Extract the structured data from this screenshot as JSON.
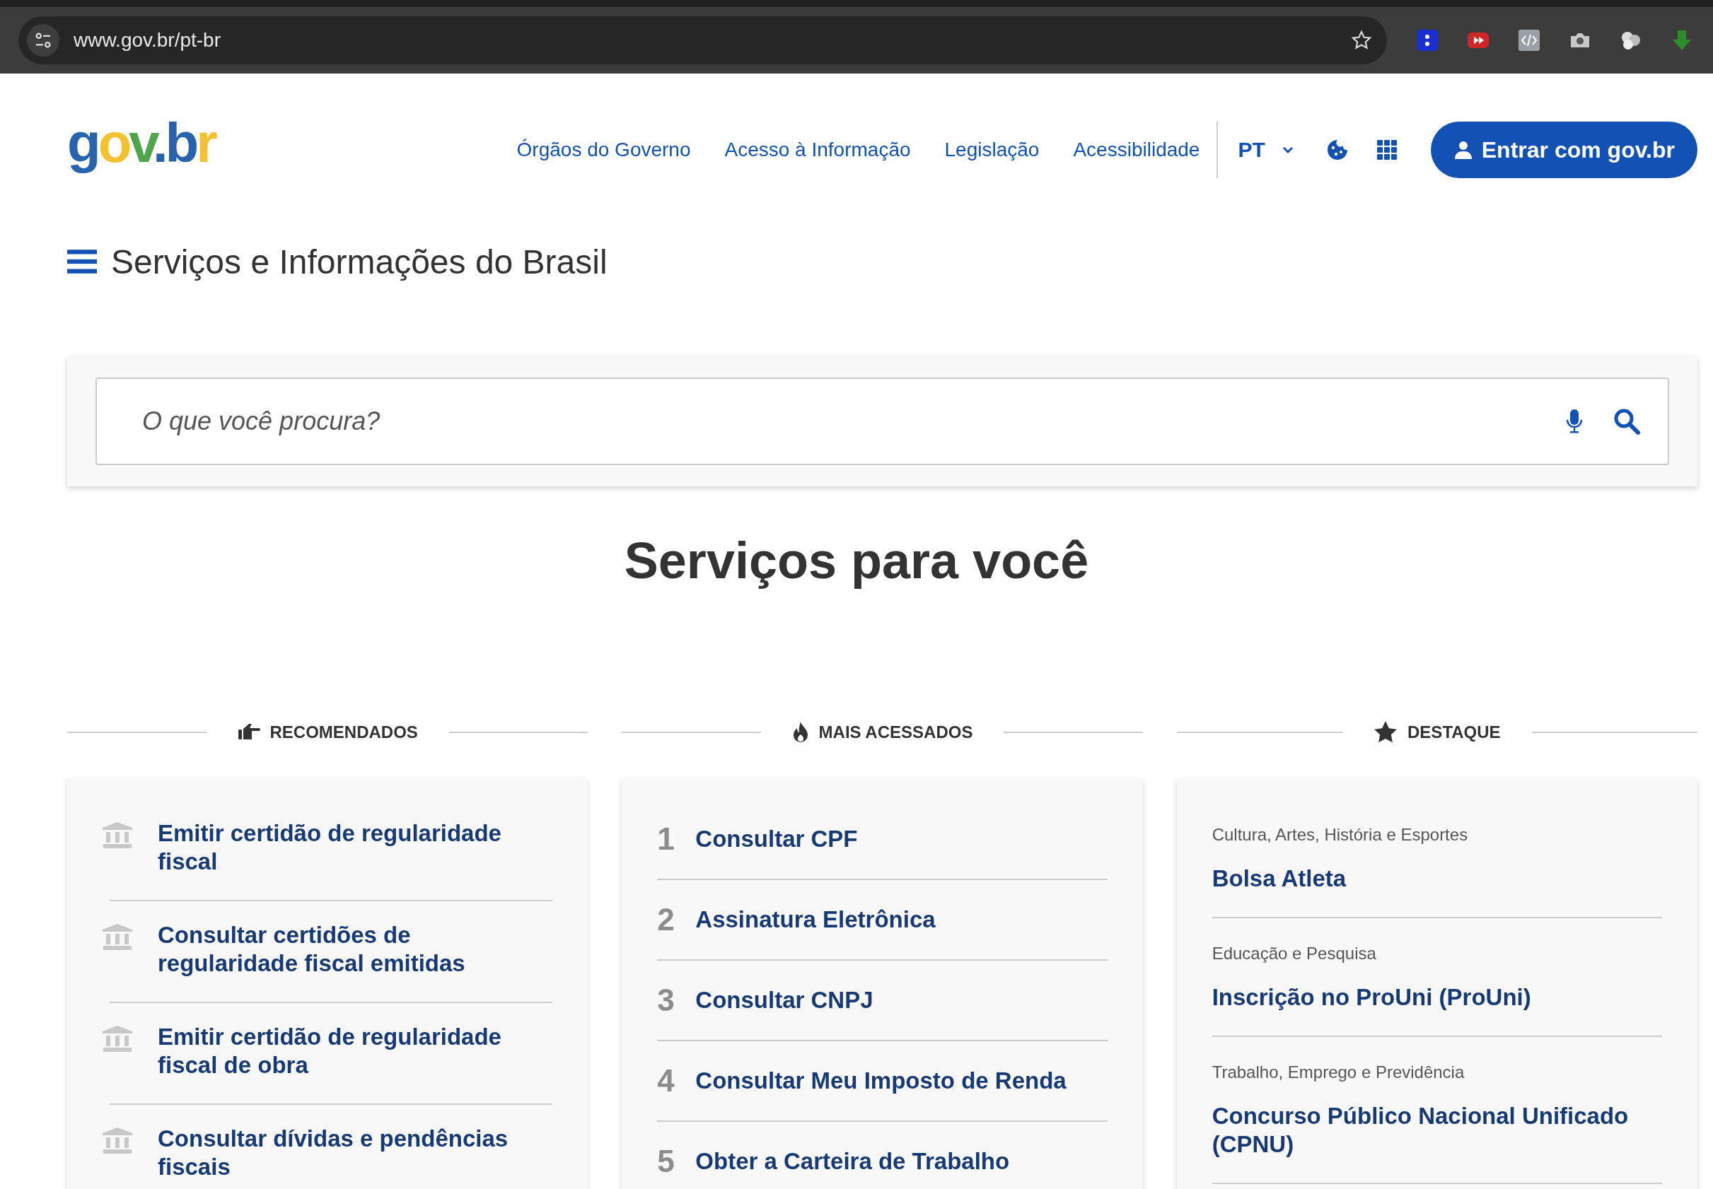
{
  "browser": {
    "url": "www.gov.br/pt-br"
  },
  "header": {
    "logo": "gov.br",
    "nav": [
      "Órgãos do Governo",
      "Acesso à Informação",
      "Legislação",
      "Acessibilidade"
    ],
    "language": "PT",
    "login_button": "Entrar com gov.br"
  },
  "page_title": "Serviços e Informações do Brasil",
  "search": {
    "placeholder": "O que você procura?"
  },
  "heading": "Serviços para você",
  "sections": [
    {
      "kind": "recommended",
      "title": "RECOMENDADOS",
      "items": [
        {
          "title": "Emitir certidão de regularidade fiscal"
        },
        {
          "title": "Consultar certidões de regularidade fiscal emitidas"
        },
        {
          "title": "Emitir certidão de regularidade fiscal de obra"
        },
        {
          "title": "Consultar dívidas e pendências fiscais"
        }
      ]
    },
    {
      "kind": "ranked",
      "title": "MAIS ACESSADOS",
      "items": [
        {
          "rank": "1",
          "title": "Consultar CPF"
        },
        {
          "rank": "2",
          "title": "Assinatura Eletrônica"
        },
        {
          "rank": "3",
          "title": "Consultar CNPJ"
        },
        {
          "rank": "4",
          "title": "Consultar Meu Imposto de Renda"
        },
        {
          "rank": "5",
          "title": "Obter a Carteira de Trabalho"
        }
      ]
    },
    {
      "kind": "featured",
      "title": "DESTAQUE",
      "items": [
        {
          "category": "Cultura, Artes, História e Esportes",
          "title": "Bolsa Atleta"
        },
        {
          "category": "Educação e Pesquisa",
          "title": "Inscrição no ProUni (ProUni)"
        },
        {
          "category": "Trabalho, Emprego e Previdência",
          "title": "Concurso Público Nacional Unificado (CPNU)"
        }
      ]
    }
  ]
}
